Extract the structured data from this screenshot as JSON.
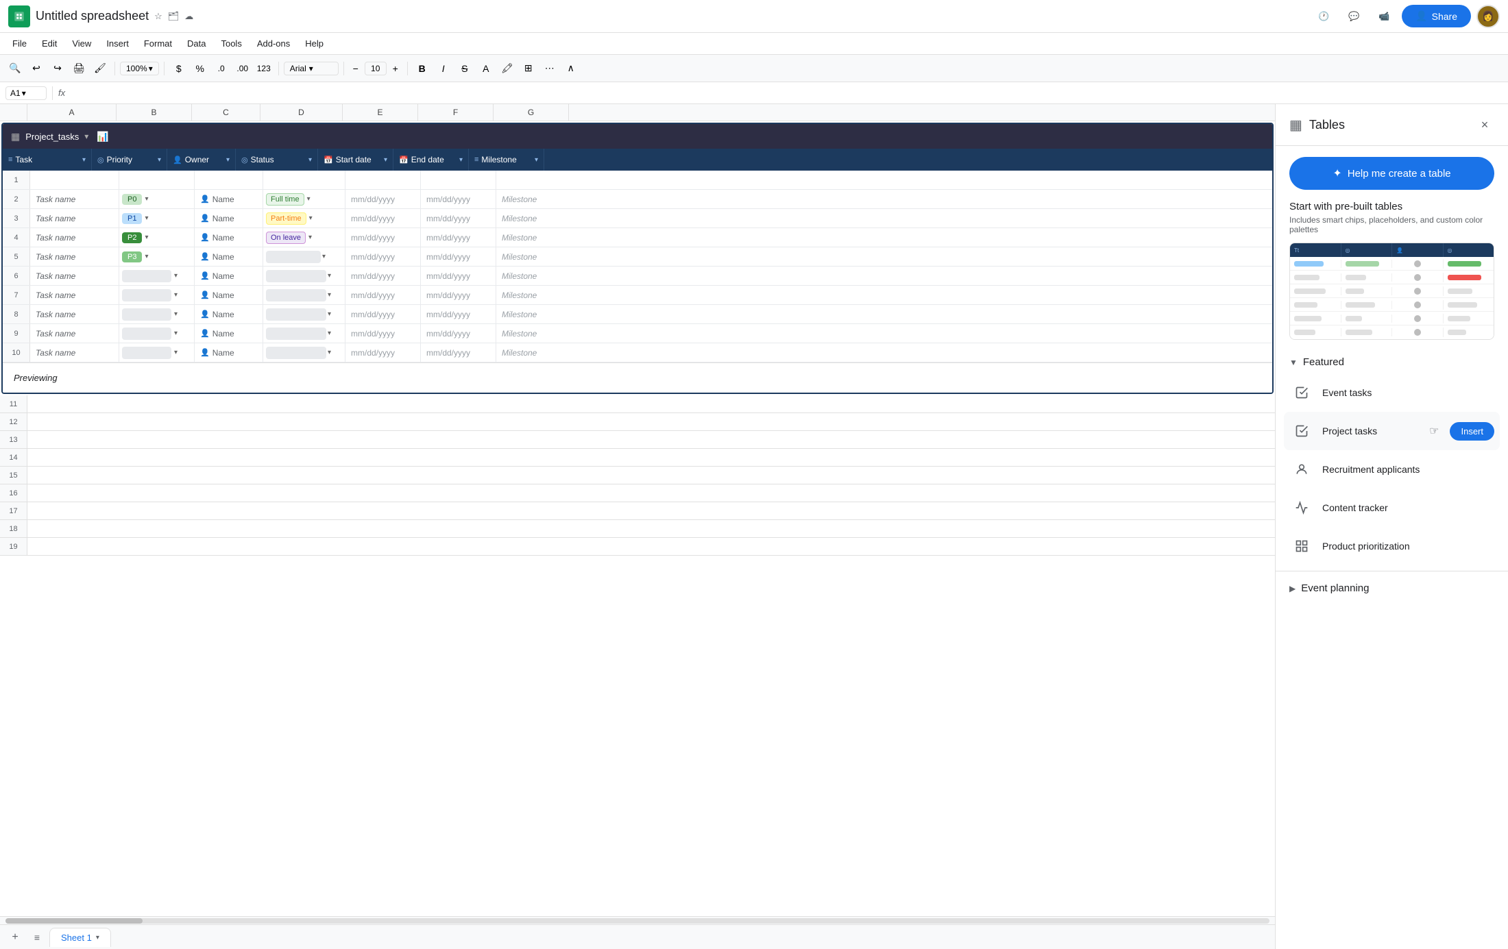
{
  "app": {
    "title": "Untitled spreadsheet",
    "icon_color": "#0f9d58"
  },
  "menu": {
    "items": [
      "File",
      "Edit",
      "View",
      "Insert",
      "Format",
      "Data",
      "Tools",
      "Add-ons",
      "Help"
    ]
  },
  "toolbar": {
    "zoom": "100%",
    "font": "Arial",
    "font_size": "10"
  },
  "formula_bar": {
    "cell_ref": "A1",
    "fx": "fx"
  },
  "spreadsheet": {
    "table_name": "Project_tasks",
    "columns": [
      {
        "icon": "≡",
        "label": "Task",
        "width": "130"
      },
      {
        "icon": "◎",
        "label": "Priority",
        "width": "110"
      },
      {
        "icon": "👤",
        "label": "Owner",
        "width": "100"
      },
      {
        "icon": "◎",
        "label": "Status",
        "width": "120"
      },
      {
        "icon": "📅",
        "label": "Start date",
        "width": "110"
      },
      {
        "icon": "📅",
        "label": "End date",
        "width": "110"
      },
      {
        "icon": "≡",
        "label": "Milestone",
        "width": "110"
      }
    ],
    "col_letters": [
      "A",
      "B",
      "C",
      "D",
      "E",
      "F",
      "G"
    ],
    "rows": [
      {
        "num": 1,
        "task": "",
        "priority": "",
        "owner": "",
        "status": "",
        "start": "",
        "end": "",
        "milestone": "",
        "is_header": true
      },
      {
        "num": 2,
        "task": "Task name",
        "priority": "P0",
        "priority_class": "chip-p0",
        "owner": "Name",
        "status": "Full time",
        "status_class": "chip-fulltime",
        "start": "mm/dd/yyyy",
        "end": "mm/dd/yyyy",
        "milestone": "Milestone"
      },
      {
        "num": 3,
        "task": "Task name",
        "priority": "P1",
        "priority_class": "chip-p1",
        "owner": "Name",
        "status": "Part-time",
        "status_class": "chip-parttime",
        "start": "mm/dd/yyyy",
        "end": "mm/dd/yyyy",
        "milestone": "Milestone"
      },
      {
        "num": 4,
        "task": "Task name",
        "priority": "P2",
        "priority_class": "chip-p2",
        "owner": "Name",
        "status": "On leave",
        "status_class": "chip-onleave",
        "start": "mm/dd/yyyy",
        "end": "mm/dd/yyyy",
        "milestone": "Milestone"
      },
      {
        "num": 5,
        "task": "Task name",
        "priority": "P3",
        "priority_class": "chip-p3",
        "owner": "Name",
        "status": "",
        "start": "mm/dd/yyyy",
        "end": "mm/dd/yyyy",
        "milestone": "Milestone"
      },
      {
        "num": 6,
        "task": "Task name",
        "priority": "",
        "owner": "Name",
        "status": "",
        "start": "mm/dd/yyyy",
        "end": "mm/dd/yyyy",
        "milestone": "Milestone"
      },
      {
        "num": 7,
        "task": "Task name",
        "priority": "",
        "owner": "Name",
        "status": "",
        "start": "mm/dd/yyyy",
        "end": "mm/dd/yyyy",
        "milestone": "Milestone"
      },
      {
        "num": 8,
        "task": "Task name",
        "priority": "",
        "owner": "Name",
        "status": "",
        "start": "mm/dd/yyyy",
        "end": "mm/dd/yyyy",
        "milestone": "Milestone"
      },
      {
        "num": 9,
        "task": "Task name",
        "priority": "",
        "owner": "Name",
        "status": "",
        "start": "mm/dd/yyyy",
        "end": "mm/dd/yyyy",
        "milestone": "Milestone"
      },
      {
        "num": 10,
        "task": "Task name",
        "priority": "",
        "owner": "Name",
        "status": "",
        "start": "mm/dd/yyyy",
        "end": "mm/dd/yyyy",
        "milestone": "Milestone"
      }
    ],
    "empty_rows": [
      11,
      12,
      13,
      14,
      15,
      16,
      17,
      18,
      19
    ],
    "preview_text": "Previewing"
  },
  "sheet_tabs": {
    "active": "Sheet 1"
  },
  "side_panel": {
    "title": "Tables",
    "close_label": "×",
    "create_btn_label": "Help me create a table",
    "prebuilt_title": "Start with pre-built tables",
    "prebuilt_subtitle": "Includes smart chips, placeholders, and custom color palettes",
    "featured_label": "Featured",
    "featured_items": [
      {
        "id": "event-tasks",
        "label": "Event tasks",
        "icon": "✓≡"
      },
      {
        "id": "project-tasks",
        "label": "Project tasks",
        "icon": "✓≡",
        "has_insert": true,
        "insert_label": "Insert"
      },
      {
        "id": "recruitment",
        "label": "Recruitment applicants",
        "icon": "👤"
      },
      {
        "id": "content-tracker",
        "label": "Content tracker",
        "icon": "〜"
      },
      {
        "id": "product-prioritization",
        "label": "Product prioritization",
        "icon": "▦"
      }
    ],
    "more_section": "Event planning"
  },
  "thumb": {
    "cols": [
      "Tt",
      "◎",
      "👤",
      "◎"
    ],
    "rows": [
      {
        "bars": [
          "#90caf9",
          "#a5d6a7",
          "#90caf9",
          "#66bb6a"
        ]
      },
      {
        "bars": [
          "#bdbdbd",
          "#bdbdbd",
          "#bdbdbd",
          "#ef5350"
        ]
      },
      {
        "bars": [
          "#bdbdbd",
          "#bdbdbd",
          "#bdbdbd",
          "#bdbdbd"
        ]
      },
      {
        "bars": [
          "#bdbdbd",
          "#bdbdbd",
          "#bdbdbd",
          "#bdbdbd"
        ]
      },
      {
        "bars": [
          "#bdbdbd",
          "#bdbdbd",
          "#bdbdbd",
          "#bdbdbd"
        ]
      },
      {
        "bars": [
          "#bdbdbd",
          "#bdbdbd",
          "#bdbdbd",
          "#bdbdbd"
        ]
      }
    ]
  }
}
